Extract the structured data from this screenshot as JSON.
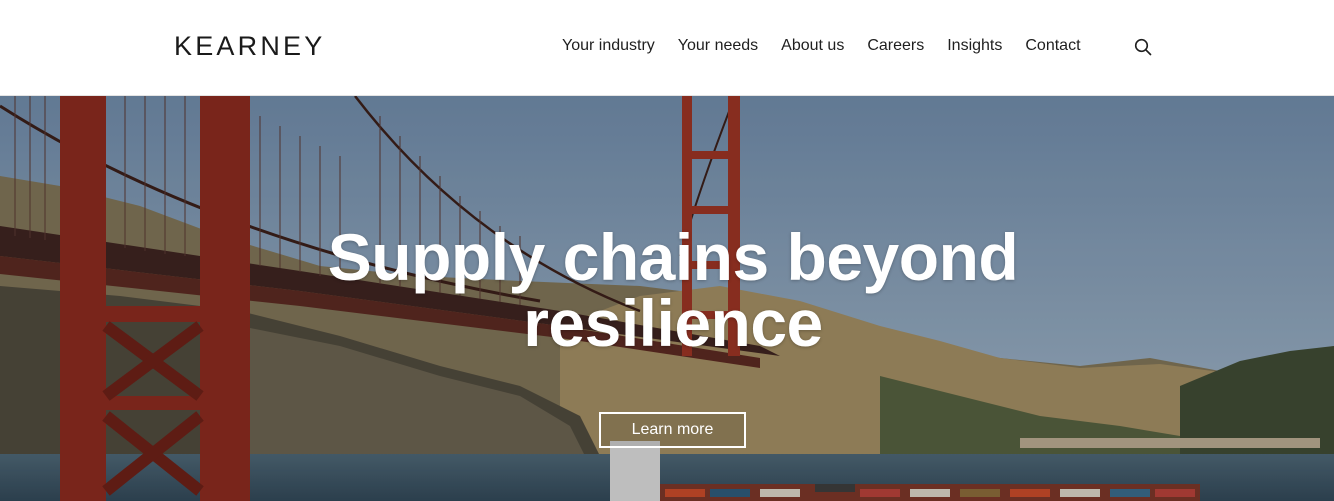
{
  "brand": {
    "logo_text": "KEARNEY"
  },
  "nav": {
    "items": [
      {
        "label": "Your industry"
      },
      {
        "label": "Your needs"
      },
      {
        "label": "About us"
      },
      {
        "label": "Careers"
      },
      {
        "label": "Insights"
      },
      {
        "label": "Contact"
      }
    ],
    "search_icon": "search-icon"
  },
  "hero": {
    "title_line1": "Supply chains beyond",
    "title_line2": "resilience",
    "cta_label": "Learn more",
    "image_subject": "golden-gate-bridge-with-container-ship",
    "colors": {
      "bridge": "#8f2a1f",
      "sky": "#7e98b5",
      "hills": "#8a7a5a",
      "water": "#3d5668"
    }
  }
}
